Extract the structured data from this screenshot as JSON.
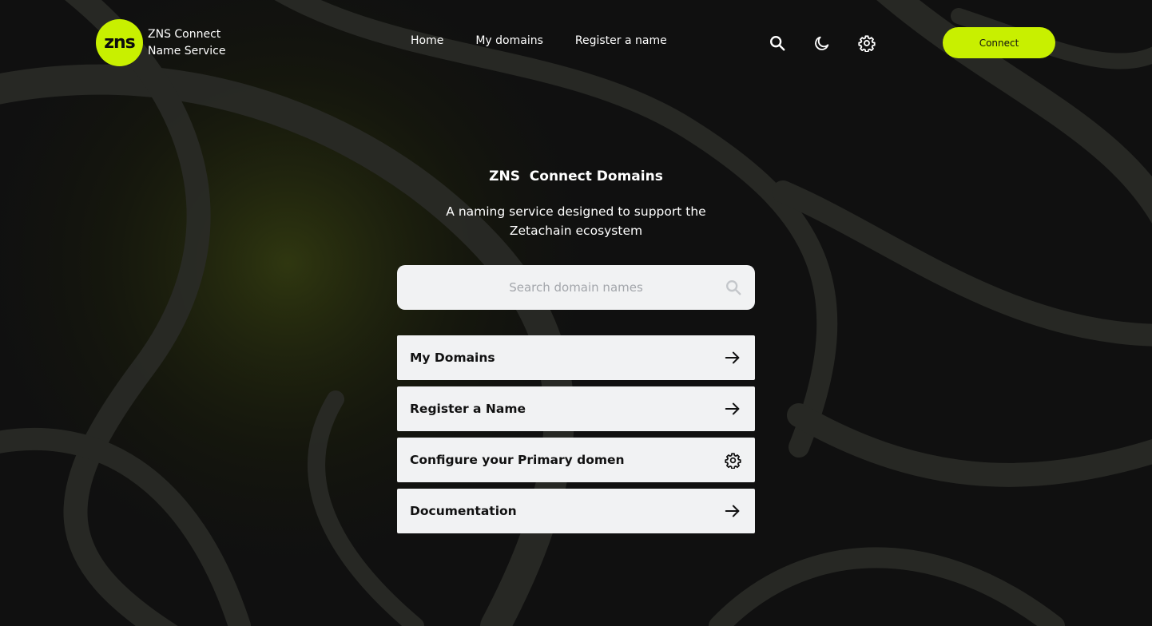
{
  "header": {
    "logo_mark": "zns",
    "logo_line1": "ZNS Connect",
    "logo_line2": "Name Service",
    "nav": [
      {
        "label": "Home"
      },
      {
        "label": "My domains"
      },
      {
        "label": "Register a name"
      }
    ],
    "icons": [
      "search-icon",
      "moon-icon",
      "gear-icon"
    ],
    "connect_label": "Connect"
  },
  "hero": {
    "title": "ZNS  Connect Domains",
    "subtitle": "A naming service designed to support the Zetachain ecosystem"
  },
  "search": {
    "placeholder": "Search domain names",
    "value": ""
  },
  "cards": [
    {
      "label": "My Domains",
      "icon": "arrow-right-icon"
    },
    {
      "label": "Register a Name",
      "icon": "arrow-right-icon"
    },
    {
      "label": "Configure your Primary domen",
      "icon": "gear-icon"
    },
    {
      "label": "Documentation",
      "icon": "arrow-right-icon"
    }
  ],
  "colors": {
    "accent": "#c8f000",
    "background": "#101010",
    "card": "#f1f2f3"
  }
}
